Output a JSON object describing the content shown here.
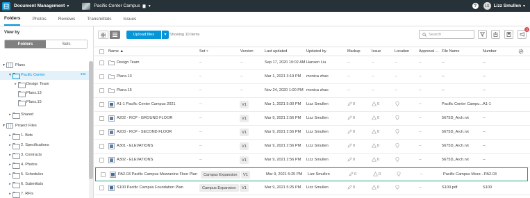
{
  "header": {
    "app_name": "Document Management",
    "project_name": "Pacific Center Campus",
    "user_initials": "LS",
    "user_name": "Lizz Smullen",
    "help_label": "?"
  },
  "tabs": [
    {
      "label": "Folders",
      "active": true
    },
    {
      "label": "Photos",
      "active": false
    },
    {
      "label": "Reviews",
      "active": false
    },
    {
      "label": "Transmittals",
      "active": false
    },
    {
      "label": "Issues",
      "active": false
    }
  ],
  "sidebar": {
    "view_by_label": "View by",
    "toggle": {
      "folders": "Folders",
      "sets": "Sets",
      "selected": "Folders"
    },
    "tree": [
      {
        "label": "Plans",
        "level": 0,
        "expanded": true,
        "type": "root"
      },
      {
        "label": "Pacific Center",
        "level": 1,
        "expanded": true,
        "selected": true
      },
      {
        "label": "Design Team",
        "level": 2
      },
      {
        "label": "Plans.13",
        "level": 2
      },
      {
        "label": "Plans.15",
        "level": 2
      },
      {
        "label": "Shared",
        "level": 1,
        "expanded": false
      },
      {
        "label": "Project Files",
        "level": 0,
        "expanded": true,
        "type": "root"
      },
      {
        "label": "1. Bids",
        "level": 1,
        "expanded": false
      },
      {
        "label": "2. Specifications",
        "level": 1,
        "expanded": false
      },
      {
        "label": "3. Contracts",
        "level": 1,
        "expanded": false
      },
      {
        "label": "4. Photos",
        "level": 1,
        "expanded": false
      },
      {
        "label": "5. Schedules",
        "level": 1,
        "expanded": false
      },
      {
        "label": "6. Submittals",
        "level": 1,
        "expanded": false
      },
      {
        "label": "7. RFIs",
        "level": 1,
        "expanded": false
      }
    ]
  },
  "toolbar": {
    "upload_label": "Upload files",
    "showing_text": "Showing 10 items",
    "search_placeholder": "Search",
    "notification_count": "3"
  },
  "table": {
    "columns": [
      "Name",
      "Set",
      "Version",
      "Last updated",
      "Updated by",
      "Markup",
      "Issue",
      "Location",
      "Approval ...",
      "File Name",
      "Number"
    ],
    "rows": [
      {
        "type": "folder",
        "name": "Design Team",
        "set": "--",
        "version": "--",
        "updated": "Sep 17, 2020 10:02 AM",
        "by": "Hansen Liu",
        "markup": "--",
        "issue": "--",
        "location": "--",
        "approval": "--",
        "file": "--",
        "number": "--"
      },
      {
        "type": "folder",
        "name": "Plans.13",
        "set": "--",
        "version": "--",
        "updated": "Mar 1, 2021 3:19 PM",
        "by": "monica zhao",
        "markup": "--",
        "issue": "--",
        "location": "--",
        "approval": "--",
        "file": "--",
        "number": "--"
      },
      {
        "type": "folder",
        "name": "Plans.15",
        "set": "--",
        "version": "--",
        "updated": "Nov 24, 2020 1:00 PM",
        "by": "monica zhao",
        "markup": "--",
        "issue": "--",
        "location": "--",
        "approval": "--",
        "file": "--",
        "number": "--"
      },
      {
        "type": "sheet",
        "name": "A1-1 Pacific Center Campus 2021",
        "set": "--",
        "version": "V1",
        "updated": "Mar 1, 2021 5:00 PM",
        "by": "Lizz Smullen",
        "markup": "0",
        "issue": "0",
        "location": "",
        "approval": "--",
        "file": "Pacific Center Campu...",
        "number": "A1-1"
      },
      {
        "type": "rvt",
        "name": "A202 - RCP - GROUND FLOOR",
        "set": "--",
        "version": "V1",
        "updated": "Mar 9, 2021 2:56 PM",
        "by": "Lizz Smullen",
        "markup": "0",
        "issue": "0",
        "location": "",
        "approval": "--",
        "file": "5675D_Arch.rvt",
        "number": "--"
      },
      {
        "type": "rvt",
        "name": "A203 - RCP - SECOND FLOOR",
        "set": "--",
        "version": "V1",
        "updated": "Mar 9, 2021 2:56 PM",
        "by": "Lizz Smullen",
        "markup": "0",
        "issue": "0",
        "location": "",
        "approval": "--",
        "file": "5675D_Arch.rvt",
        "number": "--"
      },
      {
        "type": "rvt",
        "name": "A301 - ELEVATIONS",
        "set": "--",
        "version": "V1",
        "updated": "Mar 9, 2021 2:56 PM",
        "by": "Lizz Smullen",
        "markup": "0",
        "issue": "0",
        "location": "",
        "approval": "--",
        "file": "5675D_Arch.rvt",
        "number": "--"
      },
      {
        "type": "rvt",
        "name": "A302 - ELEVATIONS",
        "set": "--",
        "version": "V1",
        "updated": "Mar 9, 2021 2:56 PM",
        "by": "Lizz Smullen",
        "markup": "0",
        "issue": "0",
        "location": "",
        "approval": "--",
        "file": "5675D_Arch.rvt",
        "number": "--"
      },
      {
        "type": "sheet",
        "name": "PA2.03 Pacific Campus Mezzanine Floor Plan",
        "set": "Campus Expansion",
        "version": "V1",
        "updated": "Mar 9, 2021 5:25 PM",
        "by": "Lizz Smullen",
        "markup": "0",
        "issue": "0",
        "location": "",
        "approval": "--",
        "file": "Pacific Campus Mezz...",
        "number": "PA2.03",
        "highlighted": true
      },
      {
        "type": "sheet",
        "name": "S100 Pacific Campus Foundation Plan",
        "set": "Campus Expansion",
        "version": "V1",
        "updated": "Mar 9, 2021 5:25 PM",
        "by": "Lizz Smullen",
        "markup": "0",
        "issue": "0",
        "location": "",
        "approval": "--",
        "file": "S100.pdf",
        "number": "S100"
      }
    ]
  },
  "colors": {
    "accent": "#0696d7",
    "topbar": "#263238",
    "highlight_border": "#1aa37a",
    "badge": "#e04b4b"
  }
}
